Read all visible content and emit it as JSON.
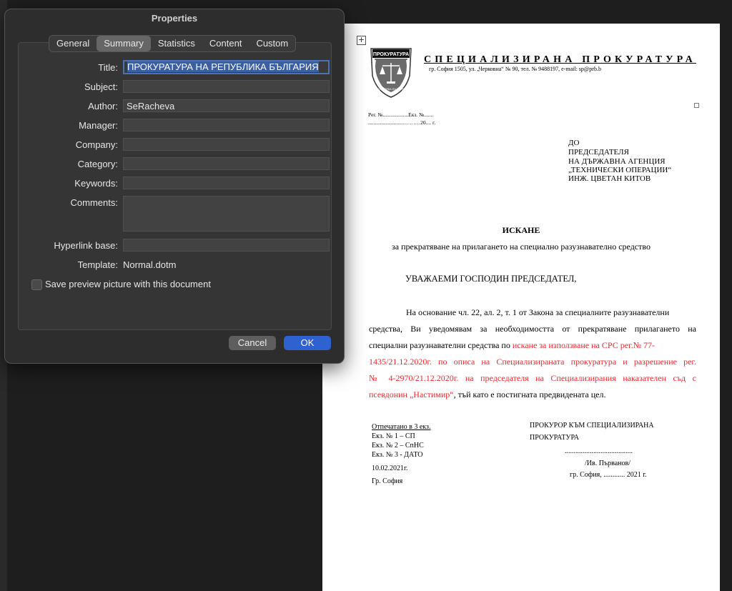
{
  "dialog": {
    "title": "Properties",
    "tabs": [
      "General",
      "Summary",
      "Statistics",
      "Content",
      "Custom"
    ],
    "active_tab": "Summary",
    "fields": {
      "title_label": "Title:",
      "title_value": "ПРОКУРАТУРА НА РЕПУБЛИКА БЪЛГАРИЯ",
      "subject_label": "Subject:",
      "subject_value": "",
      "author_label": "Author:",
      "author_value": "SeRacheva",
      "manager_label": "Manager:",
      "manager_value": "",
      "company_label": "Company:",
      "company_value": "",
      "category_label": "Category:",
      "category_value": "",
      "keywords_label": "Keywords:",
      "keywords_value": "",
      "comments_label": "Comments:",
      "comments_value": "",
      "hyperlink_label": "Hyperlink base:",
      "hyperlink_value": "",
      "template_label": "Template:",
      "template_value": "Normal.dotm"
    },
    "save_preview_label": "Save preview picture with this document",
    "save_preview_checked": false,
    "cancel_label": "Cancel",
    "ok_label": "OK"
  },
  "document": {
    "logo_text": "ПРОКУРАТУРА",
    "logo_bottom_text": "РЕПУБЛИКА БЪЛГАРИЯ",
    "org_name": "СПЕЦИАЛИЗИРАНА ПРОКУРАТУРА",
    "org_address": "гр. София 1505, ул. „Черковна“ № 90, тел. № 9488197, e-mail: sp@prb.b",
    "reg_line1": "Рег. №...................Екз. №.......",
    "reg_line2": "...........................………20.... г.",
    "to": [
      "ДО",
      "ПРЕДСЕДАТЕЛЯ",
      "НА ДЪРЖАВНА АГЕНЦИЯ",
      "„ТЕХНИЧЕСКИ ОПЕРАЦИИ“",
      "ИНЖ. ЦВЕТАН КИТОВ"
    ],
    "heading": "ИСКАНЕ",
    "subheading": "за прекратяване на прилагането на специално разузнавателно средство",
    "greeting": "УВАЖАЕМИ ГОСПОДИН ПРЕДСЕДАТЕЛ,",
    "body": {
      "line1": "На основание чл. 22, ал. 2, т. 1 от Закона за специалните разузнавателни",
      "line2": "средства, Ви уведомявам за необходимостта от прекратяване прилагането на",
      "line3_black": "специални разузнавателни средства по ",
      "line3_red": "искане за използване на СРС рег.№ 77-",
      "line4": "1435/21.12.2020г. по описа на Специализираната прокуратура и разрешение рег.",
      "line5": "№ 4-2970/21.12.2020г. на председателя на Специализирания наказателен съд с",
      "line6_red": "псевдонин „Настимир“",
      "line6_black": ", тъй като е постигната предвидената цел."
    },
    "footer_left": [
      "Отпечатано в 3 екз.",
      "Екз. № 1 – СП",
      "Екз. № 2 – СпНС",
      "Екз. № 3 -  ДАТО",
      "10.02.2021г.",
      "Гр. София"
    ],
    "footer_right": {
      "title1": "ПРОКУРОР КЪМ СПЕЦИАЛИЗИРАНА",
      "title2": "ПРОКУРАТУРА",
      "dots": "......................................",
      "name": "/Ив. Първанов/",
      "city_date": "гр. София, ............ 2021 г."
    }
  }
}
